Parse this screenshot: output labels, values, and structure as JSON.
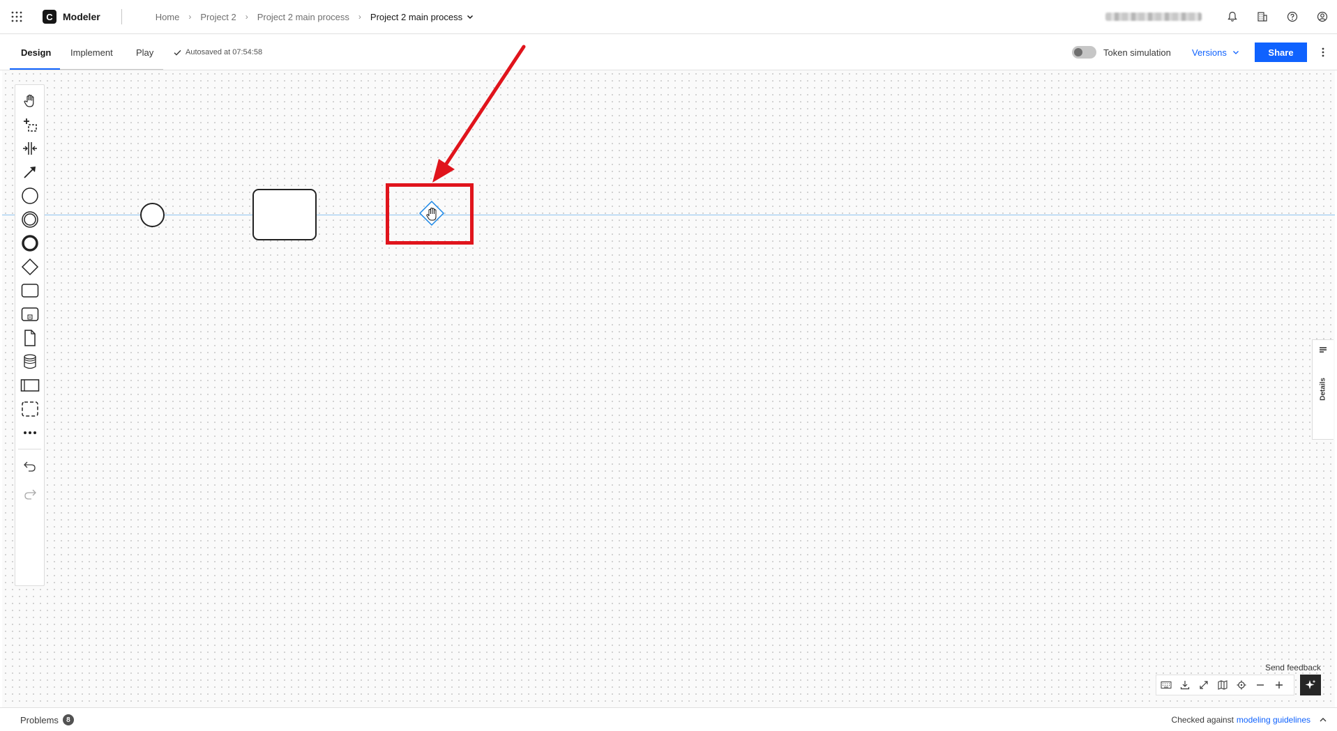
{
  "header": {
    "app_name": "Modeler",
    "logo_letter": "C",
    "breadcrumb": [
      "Home",
      "Project 2",
      "Project 2 main process"
    ],
    "current_item": "Project 2 main process",
    "icons": [
      "app-switcher-icon",
      "notification-icon",
      "organization-icon",
      "help-icon",
      "user-icon"
    ]
  },
  "subbar": {
    "tabs": [
      "Design",
      "Implement",
      "Play"
    ],
    "active_tab": "Design",
    "autosave_text": "Autosaved at 07:54:58",
    "token_simulation_label": "Token simulation",
    "token_simulation_on": false,
    "versions_label": "Versions",
    "share_label": "Share"
  },
  "palette": {
    "tools": [
      "hand-tool-icon",
      "lasso-tool-icon",
      "space-tool-icon",
      "global-connect-icon",
      "start-event-icon",
      "intermediate-event-icon",
      "end-event-icon",
      "gateway-icon",
      "task-icon",
      "subprocess-icon",
      "data-object-icon",
      "data-store-icon",
      "pool-icon",
      "group-icon",
      "more-icon"
    ],
    "history": [
      "undo-icon",
      "redo-icon"
    ]
  },
  "diagram": {
    "elements": [
      "start-event",
      "task",
      "gateway"
    ]
  },
  "details_panel": {
    "label": "Details"
  },
  "canvas_controls": {
    "send_feedback": "Send feedback",
    "buttons": [
      "keyboard-icon",
      "download-icon",
      "fullscreen-icon",
      "minimap-icon",
      "reset-view-icon",
      "zoom-out-icon",
      "zoom-in-icon"
    ]
  },
  "footer": {
    "problems_label": "Problems",
    "problems_count": "8",
    "checked_text": "Checked against",
    "guidelines_link": "modeling guidelines"
  },
  "colors": {
    "primary": "#0f62fe",
    "annotation": "#e0141c",
    "selection": "#1e88e5"
  }
}
